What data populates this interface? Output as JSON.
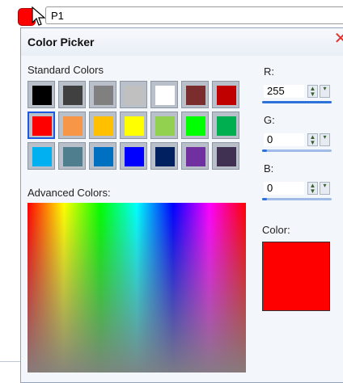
{
  "topbar": {
    "name_value": "P1",
    "swatch_color": "#ff0000"
  },
  "dialog": {
    "title": "Color Picker",
    "close_icon": "✕",
    "standard_label": "Standard Colors",
    "advanced_label": "Advanced Colors:",
    "color_label": "Color:",
    "standard_colors": [
      [
        "#000000",
        "#404040",
        "#808080",
        "#c0c0c0",
        "#ffffff",
        "#7b2c2c",
        "#c00000"
      ],
      [
        "#ff0000",
        "#f79646",
        "#ffc000",
        "#ffff00",
        "#92d050",
        "#00ff00",
        "#00b050"
      ],
      [
        "#00b0f0",
        "#4f7f8f",
        "#0070c0",
        "#0000ff",
        "#002060",
        "#7030a0",
        "#403152"
      ]
    ],
    "selected": {
      "row": 1,
      "col": 0
    },
    "rgb": {
      "r": {
        "label": "R:",
        "value": "255",
        "fill": 1.0
      },
      "g": {
        "label": "G:",
        "value": "0",
        "fill": 0.0
      },
      "b": {
        "label": "B:",
        "value": "0",
        "fill": 0.0
      }
    },
    "preview_color": "#ff0000"
  }
}
